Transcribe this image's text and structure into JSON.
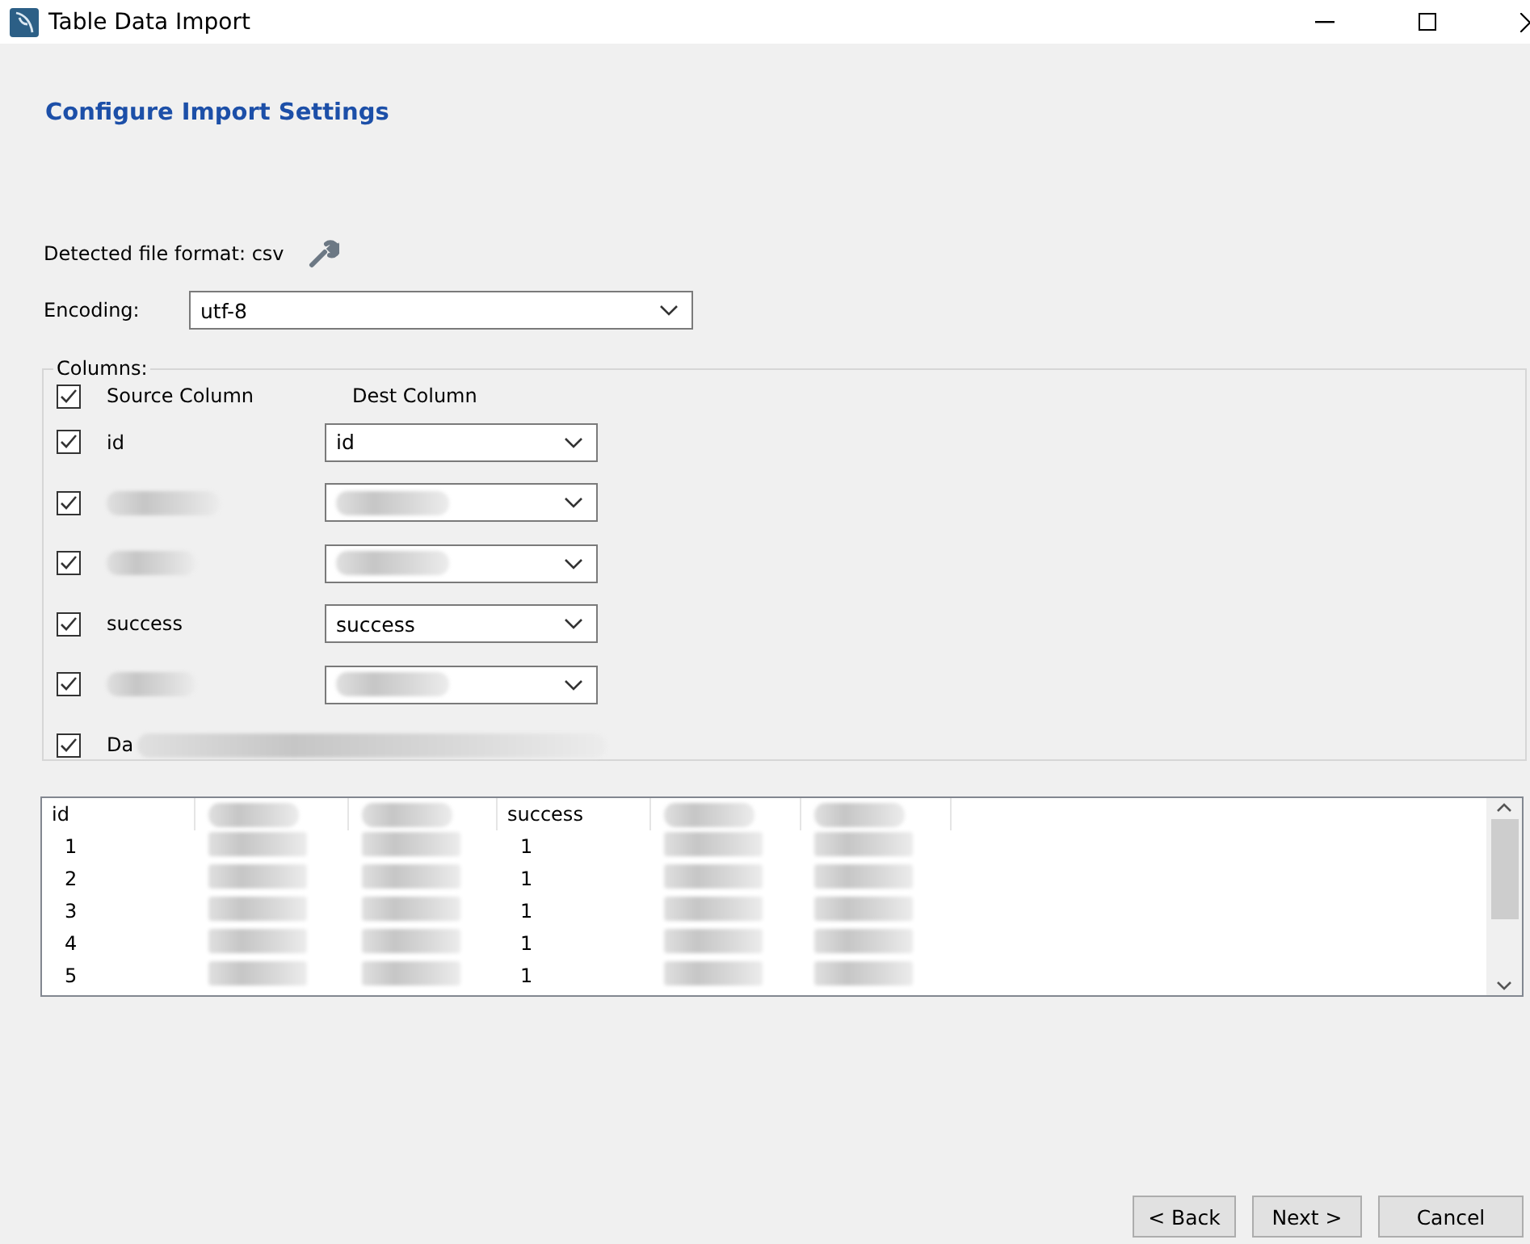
{
  "window": {
    "title": "Table Data Import"
  },
  "heading": "Configure Import Settings",
  "detected_format": "Detected file format: csv",
  "encoding": {
    "label": "Encoding:",
    "value": "utf-8"
  },
  "columns": {
    "label": "Columns:",
    "header": {
      "checked": true,
      "source": "Source Column",
      "dest": "Dest Column"
    },
    "rows": [
      {
        "kind": "plain",
        "checked": true,
        "source": "id",
        "dest": "id"
      },
      {
        "kind": "blurred",
        "checked": true
      },
      {
        "kind": "blurred",
        "checked": true
      },
      {
        "kind": "plain",
        "checked": true,
        "source": "success",
        "dest": "success"
      },
      {
        "kind": "blurred",
        "checked": true
      },
      {
        "kind": "partial",
        "checked": true,
        "source": "Da"
      }
    ]
  },
  "preview": {
    "columns": [
      {
        "kind": "text",
        "header": "id"
      },
      {
        "kind": "blurred"
      },
      {
        "kind": "blurred"
      },
      {
        "kind": "text",
        "header": "success"
      },
      {
        "kind": "blurred"
      },
      {
        "kind": "blurred"
      }
    ],
    "rows": [
      {
        "cells": [
          "1",
          "",
          "",
          "1",
          "",
          ""
        ]
      },
      {
        "cells": [
          "2",
          "",
          "",
          "1",
          "",
          ""
        ]
      },
      {
        "cells": [
          "3",
          "",
          "",
          "1",
          "",
          ""
        ]
      },
      {
        "cells": [
          "4",
          "",
          "",
          "1",
          "",
          ""
        ]
      },
      {
        "cells": [
          "5",
          "",
          "",
          "1",
          "",
          ""
        ]
      }
    ]
  },
  "buttons": [
    "< Back",
    "Next >",
    "Cancel"
  ]
}
